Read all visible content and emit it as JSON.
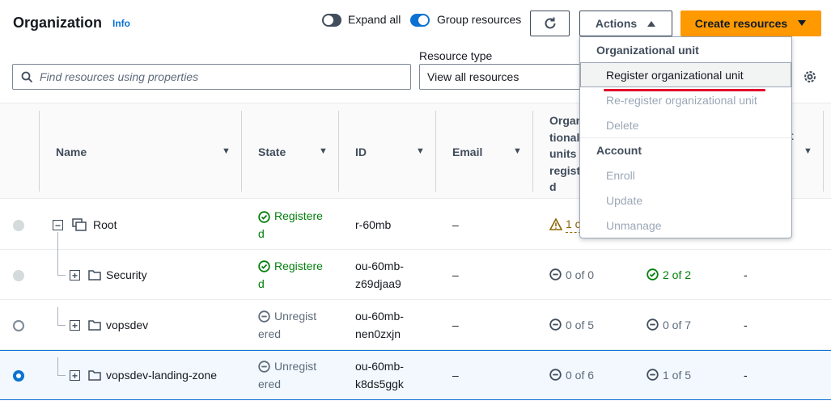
{
  "header": {
    "title": "Organization",
    "info": "Info",
    "expand_all": "Expand all",
    "group_resources": "Group resources",
    "actions": "Actions",
    "create_resources": "Create resources"
  },
  "filters": {
    "search_placeholder": "Find resources using properties",
    "resource_type_label": "Resource type",
    "resource_type_value": "View all resources"
  },
  "columns": {
    "name": "Name",
    "state": "State",
    "id": "ID",
    "email": "Email",
    "org_units": [
      "Organ",
      "tional",
      "units",
      "regist",
      "d"
    ],
    "last_fragment": "t"
  },
  "rows": [
    {
      "name": "Root",
      "state": [
        "Registere",
        "d"
      ],
      "id": [
        "r-60mb"
      ],
      "email": "–",
      "ou": "1 c",
      "accounts": "",
      "extra": ""
    },
    {
      "name": "Security",
      "state": [
        "Registere",
        "d"
      ],
      "id": [
        "ou-60mb-",
        "z69djaa9"
      ],
      "email": "–",
      "ou": "0 of 0",
      "accounts": "2 of 2",
      "extra": "-"
    },
    {
      "name": "vopsdev",
      "state": [
        "Unregist",
        "ered"
      ],
      "id": [
        "ou-60mb-",
        "nen0zxjn"
      ],
      "email": "–",
      "ou": "0 of 5",
      "accounts": "0 of 7",
      "extra": "-"
    },
    {
      "name": "vopsdev-landing-zone",
      "state": [
        "Unregist",
        "ered"
      ],
      "id": [
        "ou-60mb-",
        "k8ds5ggk"
      ],
      "email": "–",
      "ou": "0 of 6",
      "accounts": "1 of 5",
      "extra": "-"
    }
  ],
  "menu": {
    "group_ou": "Organizational unit",
    "register_ou": "Register organizational unit",
    "reregister_ou": "Re-register organizational unit",
    "delete": "Delete",
    "group_account": "Account",
    "enroll": "Enroll",
    "update": "Update",
    "unmanage": "Unmanage"
  },
  "icons": {
    "refresh": "refresh-icon",
    "settings": "gear-icon",
    "search": "search-icon"
  },
  "colors": {
    "accent": "#0972d3",
    "primary_button": "#ff9900",
    "success": "#037f0c",
    "warning": "#8d6605",
    "annotation": "#e0002a"
  }
}
